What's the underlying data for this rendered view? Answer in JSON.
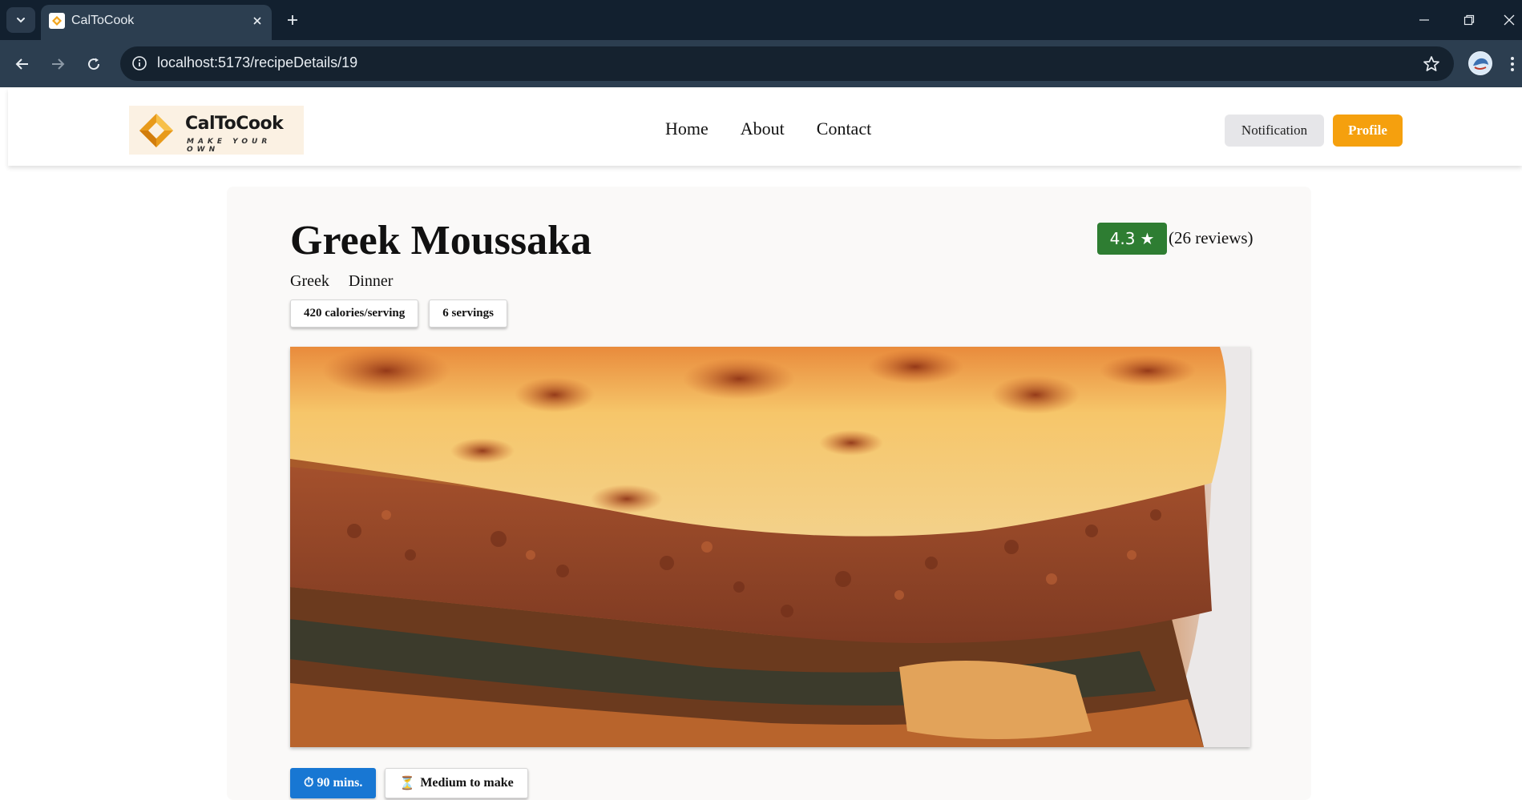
{
  "browser": {
    "tab_title": "CalToCook",
    "url": "localhost:5173/recipeDetails/19",
    "icons": {
      "tab_list": "chevron-down-icon",
      "close_tab": "close-icon",
      "new_tab": "plus-icon",
      "back": "arrow-left-icon",
      "forward": "arrow-right-icon",
      "reload": "reload-icon",
      "site_info": "info-icon",
      "bookmark": "star-outline-icon",
      "profile": "avatar",
      "menu": "kebab-menu-icon",
      "minimize": "minimize-icon",
      "restore": "restore-icon",
      "close_window": "close-icon"
    }
  },
  "header": {
    "logo": {
      "name": "CalToCook",
      "tagline": "MAKE YOUR OWN"
    },
    "nav": {
      "home": "Home",
      "about": "About",
      "contact": "Contact"
    },
    "notification_label": "Notification",
    "profile_label": "Profile"
  },
  "recipe": {
    "title": "Greek Moussaka",
    "rating": "4.3",
    "rating_icon": "★",
    "reviews": "(26 reviews)",
    "cuisine": "Greek",
    "meal_type": "Dinner",
    "calories": "420 calories/serving",
    "servings": "6 servings",
    "time_icon": "⏱",
    "time": "90 mins.",
    "difficulty_icon": "⏳",
    "difficulty": "Medium to make"
  },
  "colors": {
    "browser_frame": "#12202f",
    "toolbar": "#2c3e50",
    "rating_green": "#2e7d32",
    "profile_orange": "#f5a00e",
    "time_blue": "#1877d3"
  }
}
